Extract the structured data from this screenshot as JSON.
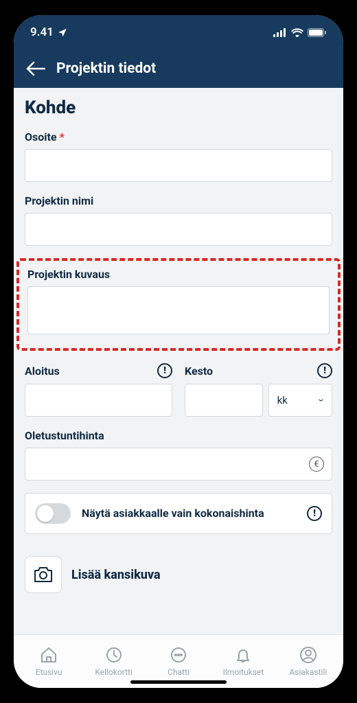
{
  "status": {
    "time": "9.41"
  },
  "nav": {
    "title": "Projektin tiedot"
  },
  "section": {
    "title": "Kohde"
  },
  "form": {
    "address": {
      "label": "Osoite",
      "required": "*",
      "value": ""
    },
    "projectName": {
      "label": "Projektin nimi",
      "value": ""
    },
    "projectDesc": {
      "label": "Projektin kuvaus",
      "value": ""
    },
    "start": {
      "label": "Aloitus",
      "value": ""
    },
    "duration": {
      "label": "Kesto",
      "value": "",
      "unit": "kk"
    },
    "hourly": {
      "label": "Oletustuntihinta",
      "value": ""
    },
    "toggle": {
      "label": "Näytä asiakkaalle vain kokonaishinta"
    },
    "cover": {
      "label": "Lisää kansikuva"
    }
  },
  "tabs": {
    "items": [
      {
        "label": "Etusivu"
      },
      {
        "label": "Kellokortti"
      },
      {
        "label": "Chatti"
      },
      {
        "label": "Ilmoitukset"
      },
      {
        "label": "Asiakastili"
      }
    ]
  }
}
